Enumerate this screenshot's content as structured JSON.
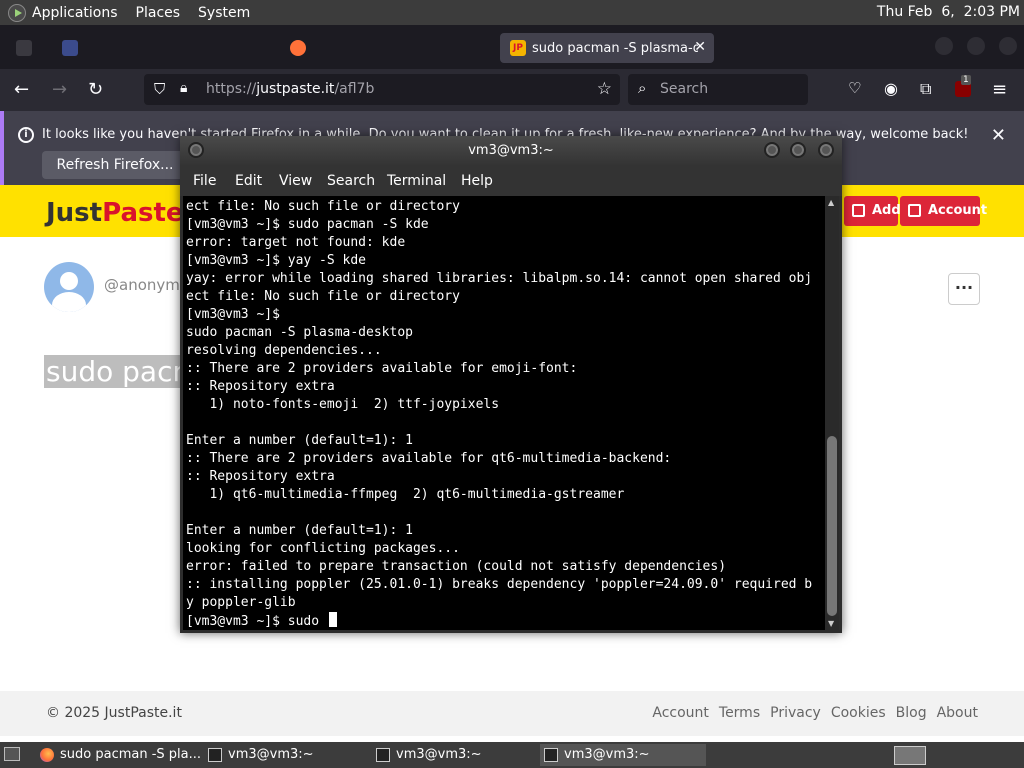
{
  "top_panel": {
    "menus": [
      "Applications",
      "Places",
      "System"
    ],
    "clock": "Thu Feb  6,  2:03 PM"
  },
  "browser": {
    "tabs": [
      {
        "label": "",
        "active": false
      },
      {
        "label": "",
        "active": false
      },
      {
        "label": "sudo pacman -S plasma-de",
        "active": true
      }
    ],
    "url": "https://justpaste.it/afl7b",
    "search_placeholder": "Search",
    "notification": {
      "message": "It looks like you haven't started Firefox in a while. Do you want to clean it up for a fresh, like-new experience? And by the way, welcome back!",
      "button": "Refresh Firefox..."
    },
    "extension_badge": "1"
  },
  "page": {
    "logo_dark": "Just",
    "logo_red": "Paste",
    "add_button": "Add",
    "account_button": "Account",
    "author": "@anonymo",
    "paste_text": "sudo pacm",
    "more_button": "···",
    "footer": {
      "copyright": "© 2025 JustPaste.it",
      "links": [
        "Account",
        "Terms",
        "Privacy",
        "Cookies",
        "Blog",
        "About"
      ]
    }
  },
  "terminal": {
    "title": "vm3@vm3:~",
    "menu": [
      "File",
      "Edit",
      "View",
      "Search",
      "Terminal",
      "Help"
    ],
    "lines": [
      "ect file: No such file or directory",
      "[vm3@vm3 ~]$ sudo pacman -S kde",
      "error: target not found: kde",
      "[vm3@vm3 ~]$ yay -S kde",
      "yay: error while loading shared libraries: libalpm.so.14: cannot open shared obj",
      "ect file: No such file or directory",
      "[vm3@vm3 ~]$",
      "sudo pacman -S plasma-desktop",
      "resolving dependencies...",
      ":: There are 2 providers available for emoji-font:",
      ":: Repository extra",
      "   1) noto-fonts-emoji  2) ttf-joypixels",
      "",
      "Enter a number (default=1): 1",
      ":: There are 2 providers available for qt6-multimedia-backend:",
      ":: Repository extra",
      "   1) qt6-multimedia-ffmpeg  2) qt6-multimedia-gstreamer",
      "",
      "Enter a number (default=1): 1",
      "looking for conflicting packages...",
      "error: failed to prepare transaction (could not satisfy dependencies)",
      ":: installing poppler (25.01.0-1) breaks dependency 'poppler=24.09.0' required b",
      "y poppler-glib"
    ],
    "prompt": "[vm3@vm3 ~]$ sudo "
  },
  "taskbar": {
    "tasks": [
      {
        "label": "sudo pacman -S pla...",
        "icon": "firefox-icon"
      },
      {
        "label": "vm3@vm3:~",
        "icon": "terminal-icon"
      },
      {
        "label": "vm3@vm3:~",
        "icon": "terminal-icon"
      },
      {
        "label": "vm3@vm3:~",
        "icon": "terminal-icon",
        "active": true
      }
    ]
  }
}
